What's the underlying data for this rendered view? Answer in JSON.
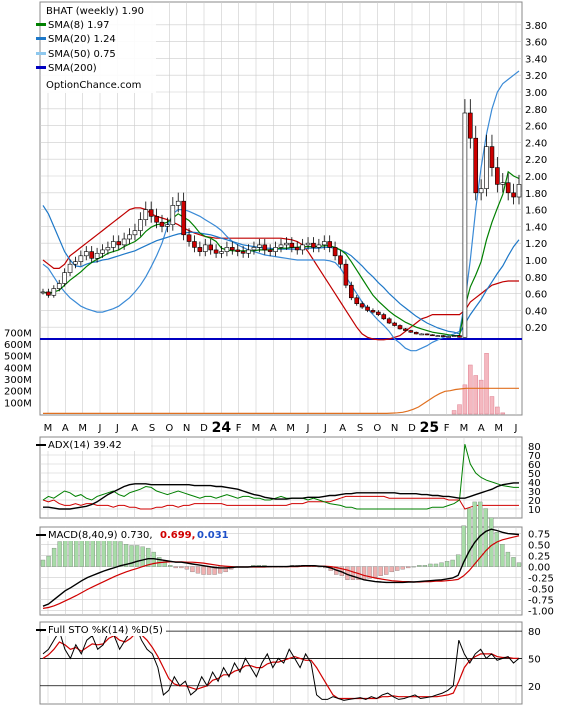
{
  "chart_data": {
    "type": "line",
    "title": "BHAT (weekly) 1.90",
    "watermark": "OptionChance.com",
    "months": [
      "M",
      "A",
      "M",
      "J",
      "J",
      "A",
      "S",
      "O",
      "N",
      "D",
      "24",
      "F",
      "M",
      "A",
      "M",
      "J",
      "J",
      "A",
      "S",
      "O",
      "N",
      "D",
      "25",
      "F",
      "M",
      "A",
      "M",
      "J"
    ],
    "price_panel": {
      "ylim": [
        0,
        4.0
      ],
      "y_ticks": [
        "3.80",
        "3.60",
        "3.40",
        "3.20",
        "3.00",
        "2.80",
        "2.60",
        "2.40",
        "2.20",
        "2.00",
        "1.80",
        "1.60",
        "1.40",
        "1.20",
        "1.00",
        "0.80",
        "0.60",
        "0.40",
        "0.20"
      ],
      "volume_ticks": [
        "700M",
        "600M",
        "500M",
        "400M",
        "300M",
        "200M",
        "100M"
      ],
      "legend": [
        {
          "label": "SMA(8) 1.97",
          "color": "#008000"
        },
        {
          "label": "SMA(20) 1.24",
          "color": "#1e78c8"
        },
        {
          "label": "SMA(50) 0.75",
          "color": "#8ec8ee"
        },
        {
          "label": "SMA(200)",
          "color": "#0000c0"
        }
      ],
      "close": [
        0.62,
        0.58,
        0.66,
        0.72,
        0.85,
        0.95,
        0.98,
        1.05,
        1.1,
        1.02,
        1.08,
        1.12,
        1.15,
        1.22,
        1.18,
        1.25,
        1.3,
        1.35,
        1.48,
        1.6,
        1.52,
        1.45,
        1.4,
        1.42,
        1.65,
        1.7,
        1.3,
        1.22,
        1.15,
        1.1,
        1.18,
        1.12,
        1.08,
        1.1,
        1.15,
        1.12,
        1.1,
        1.08,
        1.12,
        1.15,
        1.18,
        1.12,
        1.1,
        1.15,
        1.18,
        1.2,
        1.15,
        1.12,
        1.18,
        1.2,
        1.15,
        1.18,
        1.22,
        1.15,
        1.05,
        0.95,
        0.7,
        0.55,
        0.48,
        0.44,
        0.4,
        0.38,
        0.35,
        0.3,
        0.25,
        0.22,
        0.18,
        0.16,
        0.14,
        0.12,
        0.12,
        0.11,
        0.1,
        0.1,
        0.09,
        0.09,
        0.1,
        0.08,
        2.75,
        2.45,
        1.8,
        1.85,
        2.35,
        2.1,
        1.9,
        1.92,
        1.8,
        1.75,
        1.9
      ],
      "sma8": [
        0.62,
        0.6,
        0.62,
        0.64,
        0.7,
        0.76,
        0.81,
        0.86,
        0.92,
        0.97,
        1.01,
        1.04,
        1.08,
        1.1,
        1.12,
        1.16,
        1.19,
        1.22,
        1.27,
        1.34,
        1.39,
        1.42,
        1.43,
        1.45,
        1.5,
        1.55,
        1.51,
        1.47,
        1.4,
        1.32,
        1.28,
        1.26,
        1.22,
        1.14,
        1.12,
        1.11,
        1.11,
        1.11,
        1.11,
        1.11,
        1.12,
        1.12,
        1.12,
        1.13,
        1.14,
        1.14,
        1.15,
        1.15,
        1.16,
        1.16,
        1.16,
        1.16,
        1.17,
        1.17,
        1.15,
        1.12,
        1.07,
        0.98,
        0.88,
        0.78,
        0.68,
        0.58,
        0.51,
        0.45,
        0.39,
        0.34,
        0.3,
        0.26,
        0.23,
        0.2,
        0.18,
        0.16,
        0.14,
        0.13,
        0.12,
        0.11,
        0.1,
        0.1,
        0.44,
        0.68,
        0.82,
        0.98,
        1.24,
        1.45,
        1.62,
        1.78,
        2.05,
        2.0,
        1.97
      ],
      "sma20": [
        1.65,
        1.55,
        1.4,
        1.25,
        1.1,
        1.0,
        0.93,
        0.92,
        0.95,
        0.97,
        0.98,
        1.0,
        1.01,
        1.03,
        1.05,
        1.07,
        1.09,
        1.11,
        1.14,
        1.17,
        1.2,
        1.23,
        1.25,
        1.27,
        1.29,
        1.31,
        1.32,
        1.33,
        1.33,
        1.32,
        1.31,
        1.3,
        1.28,
        1.26,
        1.24,
        1.22,
        1.2,
        1.18,
        1.17,
        1.16,
        1.15,
        1.14,
        1.14,
        1.13,
        1.13,
        1.13,
        1.13,
        1.13,
        1.13,
        1.14,
        1.14,
        1.14,
        1.15,
        1.15,
        1.14,
        1.12,
        1.09,
        1.05,
        0.99,
        0.93,
        0.86,
        0.8,
        0.73,
        0.67,
        0.6,
        0.54,
        0.48,
        0.43,
        0.38,
        0.33,
        0.29,
        0.25,
        0.22,
        0.19,
        0.17,
        0.15,
        0.14,
        0.12,
        0.24,
        0.35,
        0.44,
        0.53,
        0.64,
        0.74,
        0.84,
        0.93,
        1.05,
        1.16,
        1.24
      ],
      "sma50": [
        0.95,
        0.9,
        0.8,
        0.7,
        0.62,
        0.55,
        0.5,
        0.45,
        0.42,
        0.4,
        0.38,
        0.38,
        0.4,
        0.42,
        0.45,
        0.5,
        0.55,
        0.62,
        0.7,
        0.8,
        0.92,
        1.05,
        1.2,
        1.4,
        1.55,
        1.6,
        1.6,
        1.58,
        1.55,
        1.52,
        1.48,
        1.44,
        1.4,
        1.35,
        1.28,
        1.22,
        1.18,
        1.15,
        1.12,
        1.1,
        1.08,
        1.06,
        1.05,
        1.04,
        1.03,
        1.02,
        1.01,
        1.0,
        1.0,
        1.0,
        1.0,
        1.0,
        1.0,
        0.99,
        0.97,
        0.9,
        0.8,
        0.7,
        0.6,
        0.5,
        0.42,
        0.35,
        0.28,
        0.22,
        0.15,
        0.06,
        0.01,
        -0.05,
        -0.08,
        -0.08,
        -0.05,
        -0.02,
        0.02,
        0.05,
        0.08,
        0.1,
        0.12,
        0.15,
        0.5,
        1.0,
        1.6,
        2.1,
        2.5,
        2.8,
        3.0,
        3.1,
        3.15,
        3.2,
        3.25
      ],
      "sma200": 0.06,
      "bollinger_upper": [
        1.0,
        0.95,
        0.9,
        0.9,
        0.95,
        1.05,
        1.1,
        1.15,
        1.2,
        1.25,
        1.3,
        1.35,
        1.4,
        1.45,
        1.5,
        1.55,
        1.6,
        1.62,
        1.62,
        1.6,
        1.55,
        1.52,
        1.5,
        1.48,
        1.45,
        1.42,
        1.38,
        1.35,
        1.32,
        1.3,
        1.28,
        1.27,
        1.26,
        1.26,
        1.26,
        1.26,
        1.26,
        1.26,
        1.26,
        1.26,
        1.26,
        1.26,
        1.26,
        1.26,
        1.26,
        1.25,
        1.24,
        1.22,
        1.18,
        1.1,
        1.0,
        0.9,
        0.8,
        0.7,
        0.6,
        0.5,
        0.4,
        0.3,
        0.2,
        0.12,
        0.08,
        0.06,
        0.05,
        0.05,
        0.06,
        0.08,
        0.1,
        0.15,
        0.2,
        0.25,
        0.3,
        0.32,
        0.35,
        0.35,
        0.35,
        0.35,
        0.35,
        0.35,
        0.4,
        0.5,
        0.55,
        0.6,
        0.65,
        0.7,
        0.72,
        0.74,
        0.75,
        0.75,
        0.75
      ],
      "volume_m": [
        0,
        0,
        0,
        0,
        0,
        0,
        0,
        0,
        0,
        0,
        0,
        0,
        0,
        0,
        0,
        0,
        0,
        0,
        0,
        0,
        0,
        0,
        0,
        0,
        0,
        0,
        0,
        0,
        0,
        0,
        0,
        0,
        0,
        0,
        0,
        0,
        0,
        0,
        0,
        0,
        0,
        0,
        0,
        0,
        0,
        0,
        0,
        0,
        0,
        0,
        0,
        0,
        0,
        0,
        0,
        0,
        0,
        0,
        0,
        0,
        0,
        0,
        0,
        0,
        0,
        0,
        0,
        0,
        0,
        0,
        0,
        0,
        0,
        0,
        0,
        0,
        30,
        80,
        250,
        420,
        330,
        290,
        520,
        150,
        60,
        10,
        0,
        0,
        0,
        0,
        0
      ],
      "volume_avg_m": [
        5,
        5,
        5,
        5,
        5,
        5,
        5,
        5,
        5,
        5,
        5,
        5,
        5,
        5,
        5,
        5,
        5,
        5,
        5,
        5,
        5,
        5,
        5,
        5,
        5,
        5,
        5,
        5,
        5,
        5,
        5,
        5,
        5,
        5,
        5,
        5,
        5,
        5,
        5,
        5,
        5,
        5,
        5,
        5,
        5,
        5,
        5,
        5,
        5,
        5,
        5,
        5,
        5,
        5,
        5,
        5,
        5,
        5,
        5,
        5,
        5,
        5,
        5,
        5,
        5,
        5,
        8,
        10,
        15,
        25,
        40,
        60,
        90,
        120,
        150,
        175,
        195,
        200,
        210,
        215,
        220,
        220,
        220,
        220,
        220,
        220,
        220,
        220,
        220,
        220,
        220
      ]
    },
    "adx_panel": {
      "label": "ADX(14) 39.42",
      "ylim": [
        0,
        90
      ],
      "y_ticks": [
        "80",
        "70",
        "60",
        "50",
        "40",
        "30",
        "20",
        "10"
      ],
      "adx": [
        12,
        12,
        11,
        10,
        10,
        10,
        11,
        12,
        13,
        15,
        18,
        22,
        26,
        29,
        32,
        35,
        37,
        38,
        38,
        38,
        37,
        37,
        37,
        37,
        37,
        37,
        37,
        37,
        36,
        36,
        36,
        36,
        35,
        35,
        34,
        33,
        32,
        30,
        28,
        26,
        25,
        23,
        22,
        21,
        21,
        21,
        22,
        22,
        22,
        23,
        23,
        23,
        24,
        25,
        25,
        26,
        27,
        27,
        28,
        28,
        28,
        28,
        28,
        28,
        28,
        28,
        27,
        27,
        27,
        27,
        26,
        26,
        25,
        25,
        24,
        24,
        23,
        22,
        22,
        24,
        26,
        28,
        30,
        32,
        35,
        37,
        38,
        39,
        39
      ],
      "plus_di": [
        20,
        24,
        22,
        26,
        30,
        28,
        24,
        26,
        22,
        20,
        24,
        26,
        28,
        30,
        26,
        24,
        28,
        30,
        32,
        35,
        34,
        30,
        28,
        26,
        28,
        30,
        28,
        26,
        24,
        22,
        24,
        24,
        22,
        24,
        26,
        24,
        22,
        24,
        24,
        22,
        22,
        20,
        20,
        22,
        24,
        22,
        22,
        22,
        22,
        20,
        22,
        20,
        18,
        16,
        15,
        14,
        12,
        12,
        10,
        10,
        10,
        10,
        10,
        10,
        10,
        10,
        10,
        10,
        10,
        10,
        10,
        10,
        12,
        12,
        12,
        14,
        16,
        20,
        82,
        60,
        50,
        45,
        42,
        40,
        38,
        36,
        35,
        34,
        34
      ],
      "minus_di": [
        20,
        18,
        20,
        16,
        14,
        14,
        16,
        14,
        16,
        16,
        14,
        14,
        14,
        12,
        14,
        14,
        12,
        12,
        10,
        10,
        10,
        12,
        12,
        14,
        14,
        12,
        14,
        14,
        16,
        16,
        16,
        16,
        16,
        16,
        14,
        14,
        14,
        14,
        14,
        14,
        14,
        14,
        14,
        14,
        14,
        14,
        16,
        16,
        16,
        18,
        18,
        18,
        18,
        18,
        20,
        22,
        24,
        24,
        24,
        24,
        24,
        24,
        24,
        24,
        22,
        22,
        22,
        22,
        22,
        22,
        22,
        22,
        22,
        22,
        22,
        20,
        20,
        20,
        10,
        12,
        14,
        14,
        14,
        14,
        14,
        14,
        14,
        14,
        14
      ]
    },
    "macd_panel": {
      "label": "MACD(8,40,9) 0.730,",
      "signal_label": "0.699,",
      "hist_label": "0.031",
      "ylim": [
        -1.1,
        0.9
      ],
      "y_ticks": [
        "0.75",
        "0.50",
        "0.25",
        "0.00",
        "-0.25",
        "-0.50",
        "-0.75",
        "-1.00"
      ],
      "macd": [
        -0.9,
        -0.85,
        -0.75,
        -0.65,
        -0.55,
        -0.48,
        -0.4,
        -0.32,
        -0.25,
        -0.2,
        -0.15,
        -0.1,
        -0.06,
        -0.02,
        0.02,
        0.05,
        0.08,
        0.12,
        0.15,
        0.18,
        0.18,
        0.16,
        0.14,
        0.12,
        0.1,
        0.1,
        0.08,
        0.06,
        0.04,
        0.02,
        0.0,
        -0.02,
        -0.03,
        -0.03,
        -0.02,
        -0.01,
        -0.01,
        -0.01,
        0.0,
        0.0,
        0.0,
        0.0,
        0.0,
        0.0,
        0.0,
        0.01,
        0.01,
        0.02,
        0.02,
        0.02,
        0.01,
        0.0,
        -0.03,
        -0.08,
        -0.12,
        -0.18,
        -0.22,
        -0.26,
        -0.3,
        -0.32,
        -0.34,
        -0.35,
        -0.36,
        -0.36,
        -0.36,
        -0.36,
        -0.35,
        -0.35,
        -0.34,
        -0.33,
        -0.32,
        -0.31,
        -0.3,
        -0.28,
        -0.26,
        -0.2,
        0.1,
        0.35,
        0.55,
        0.7,
        0.8,
        0.85,
        0.82,
        0.78,
        0.75,
        0.74,
        0.73
      ],
      "signal": [
        -0.95,
        -0.93,
        -0.89,
        -0.84,
        -0.78,
        -0.72,
        -0.66,
        -0.59,
        -0.52,
        -0.46,
        -0.4,
        -0.34,
        -0.28,
        -0.22,
        -0.17,
        -0.12,
        -0.08,
        -0.04,
        0.0,
        0.04,
        0.07,
        0.09,
        0.1,
        0.11,
        0.11,
        0.11,
        0.1,
        0.1,
        0.09,
        0.08,
        0.06,
        0.04,
        0.02,
        0.01,
        0.0,
        -0.01,
        -0.01,
        -0.01,
        -0.01,
        -0.01,
        -0.01,
        0.0,
        0.0,
        0.0,
        0.0,
        0.0,
        0.0,
        0.01,
        0.01,
        0.01,
        0.01,
        0.01,
        0.0,
        -0.02,
        -0.05,
        -0.08,
        -0.12,
        -0.16,
        -0.2,
        -0.23,
        -0.26,
        -0.28,
        -0.3,
        -0.32,
        -0.33,
        -0.34,
        -0.34,
        -0.35,
        -0.35,
        -0.34,
        -0.34,
        -0.33,
        -0.33,
        -0.32,
        -0.31,
        -0.29,
        -0.21,
        -0.09,
        0.06,
        0.21,
        0.36,
        0.48,
        0.56,
        0.61,
        0.64,
        0.67,
        0.7
      ]
    },
    "sto_panel": {
      "label": "Full STO %K(14) %D(5)",
      "ylim": [
        0,
        90
      ],
      "y_ticks": [
        "80",
        "50",
        "20"
      ],
      "k": [
        55,
        60,
        70,
        80,
        60,
        50,
        65,
        55,
        70,
        75,
        60,
        65,
        80,
        75,
        60,
        70,
        80,
        85,
        70,
        60,
        55,
        40,
        10,
        15,
        30,
        20,
        25,
        10,
        15,
        30,
        20,
        35,
        25,
        40,
        30,
        45,
        35,
        50,
        40,
        30,
        45,
        55,
        40,
        50,
        45,
        60,
        50,
        40,
        55,
        45,
        10,
        5,
        5,
        8,
        6,
        4,
        5,
        6,
        7,
        5,
        8,
        6,
        10,
        12,
        8,
        5,
        6,
        8,
        10,
        6,
        7,
        8,
        10,
        12,
        15,
        20,
        70,
        55,
        45,
        55,
        60,
        50,
        55,
        48,
        50,
        52,
        45,
        50
      ],
      "d": [
        50,
        54,
        60,
        68,
        65,
        60,
        62,
        58,
        62,
        66,
        65,
        66,
        72,
        75,
        70,
        68,
        72,
        78,
        76,
        70,
        62,
        52,
        40,
        28,
        22,
        20,
        20,
        18,
        16,
        18,
        20,
        26,
        28,
        32,
        32,
        36,
        38,
        42,
        42,
        40,
        40,
        44,
        46,
        46,
        48,
        50,
        52,
        50,
        48,
        48,
        40,
        30,
        20,
        10,
        6,
        6,
        6,
        6,
        6,
        6,
        6,
        6,
        8,
        8,
        9,
        8,
        8,
        8,
        8,
        8,
        8,
        8,
        8,
        9,
        10,
        12,
        25,
        40,
        48,
        52,
        55,
        55,
        55,
        52,
        51,
        51,
        50,
        50
      ]
    }
  }
}
